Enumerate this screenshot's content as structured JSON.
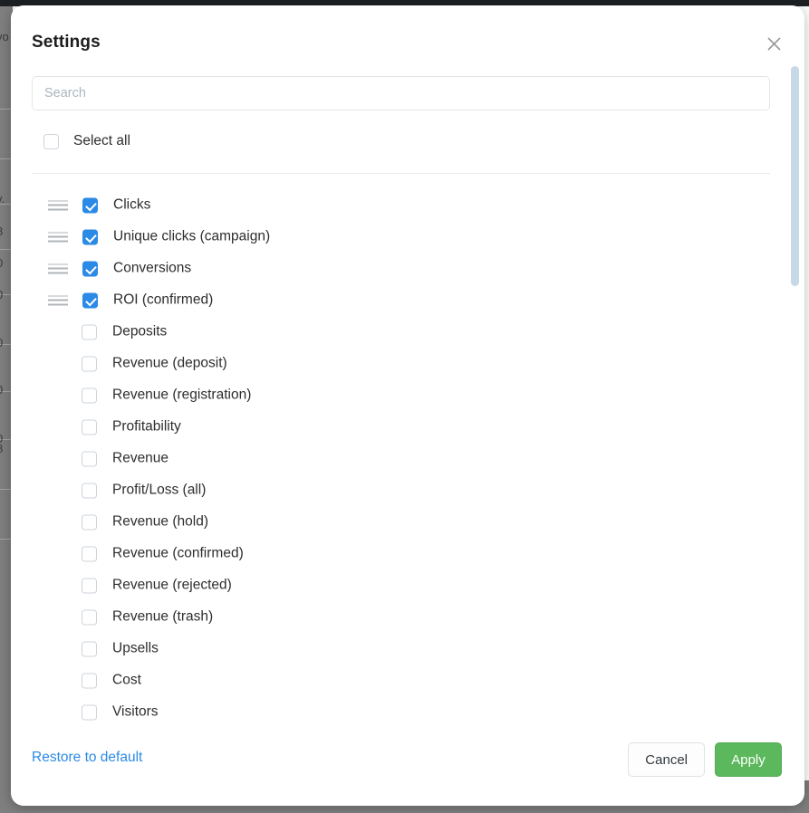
{
  "backdrop": {
    "chart_axis_labels": [
      "vo",
      "v.",
      "8",
      "0",
      "0",
      "0",
      "0",
      "0",
      "8"
    ]
  },
  "modal": {
    "title": "Settings",
    "close_icon": "close-icon",
    "search": {
      "placeholder": "Search",
      "value": ""
    },
    "select_all": {
      "label": "Select all",
      "checked": false
    },
    "options": [
      {
        "label": "Clicks",
        "checked": true,
        "draggable": true
      },
      {
        "label": "Unique clicks (campaign)",
        "checked": true,
        "draggable": true
      },
      {
        "label": "Conversions",
        "checked": true,
        "draggable": true
      },
      {
        "label": "ROI (confirmed)",
        "checked": true,
        "draggable": true
      },
      {
        "label": "Deposits",
        "checked": false,
        "draggable": false
      },
      {
        "label": "Revenue (deposit)",
        "checked": false,
        "draggable": false
      },
      {
        "label": "Revenue (registration)",
        "checked": false,
        "draggable": false
      },
      {
        "label": "Profitability",
        "checked": false,
        "draggable": false
      },
      {
        "label": "Revenue",
        "checked": false,
        "draggable": false
      },
      {
        "label": "Profit/Loss (all)",
        "checked": false,
        "draggable": false
      },
      {
        "label": "Revenue (hold)",
        "checked": false,
        "draggable": false
      },
      {
        "label": "Revenue (confirmed)",
        "checked": false,
        "draggable": false
      },
      {
        "label": "Revenue (rejected)",
        "checked": false,
        "draggable": false
      },
      {
        "label": "Revenue (trash)",
        "checked": false,
        "draggable": false
      },
      {
        "label": "Upsells",
        "checked": false,
        "draggable": false
      },
      {
        "label": "Cost",
        "checked": false,
        "draggable": false
      },
      {
        "label": "Visitors",
        "checked": false,
        "draggable": false
      }
    ],
    "footer": {
      "restore_label": "Restore to default",
      "cancel_label": "Cancel",
      "apply_label": "Apply"
    }
  },
  "colors": {
    "accent_blue": "#2b8ae6",
    "apply_green": "#5cb85c",
    "scrollbar_thumb": "#c7d8e6",
    "backdrop_gray": "#7f7f7f",
    "topbar_dark": "#1c2023"
  }
}
